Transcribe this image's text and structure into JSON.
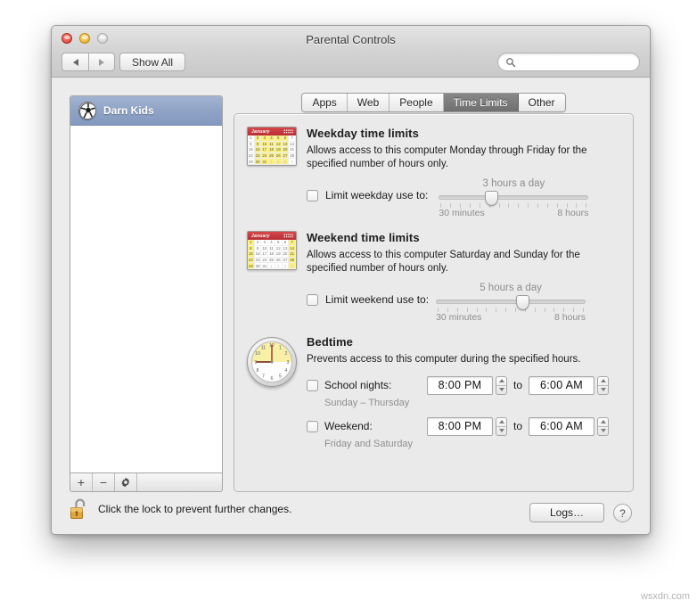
{
  "window": {
    "title": "Parental Controls",
    "traffic": {
      "close": "close-button",
      "minimize": "minimize-button",
      "zoom": "zoom-button"
    },
    "toolbar": {
      "back_label": "back",
      "forward_label": "forward",
      "show_all_label": "Show All",
      "search_placeholder": "",
      "search_value": ""
    }
  },
  "sidebar": {
    "users": [
      {
        "name": "Darn Kids",
        "avatar": "soccer-ball-icon",
        "selected": true
      }
    ],
    "toolbar": {
      "add_label": "+",
      "remove_label": "−",
      "action_label": "gear"
    }
  },
  "tabs": [
    {
      "label": "Apps",
      "active": false
    },
    {
      "label": "Web",
      "active": false
    },
    {
      "label": "People",
      "active": false
    },
    {
      "label": "Time Limits",
      "active": true
    },
    {
      "label": "Other",
      "active": false
    }
  ],
  "sections": {
    "weekday": {
      "icon": "calendar-icon",
      "calendar_month": "January",
      "title": "Weekday time limits",
      "description": "Allows access to this computer Monday through Friday for the specified number of hours only.",
      "checkbox_label": "Limit weekday use to:",
      "checked": false,
      "slider": {
        "value_label": "3 hours a day",
        "min_label": "30 minutes",
        "max_label": "8 hours",
        "percent": 35,
        "ticks": 16
      }
    },
    "weekend": {
      "icon": "calendar-icon",
      "calendar_month": "January",
      "title": "Weekend time limits",
      "description": "Allows access to this computer Saturday and Sunday for the specified number of hours only.",
      "checkbox_label": "Limit weekend use to:",
      "checked": false,
      "slider": {
        "value_label": "5 hours a day",
        "min_label": "30 minutes",
        "max_label": "8 hours",
        "percent": 58,
        "ticks": 16
      }
    },
    "bedtime": {
      "icon": "clock-icon",
      "title": "Bedtime",
      "description": "Prevents access to this computer during the specified hours.",
      "rows": [
        {
          "checkbox_label": "School nights:",
          "checked": false,
          "start_time": "8:00 PM",
          "to_label": "to",
          "end_time": "6:00 AM",
          "note": "Sunday – Thursday"
        },
        {
          "checkbox_label": "Weekend:",
          "checked": false,
          "start_time": "8:00 PM",
          "to_label": "to",
          "end_time": "6:00 AM",
          "note": "Friday and Saturday"
        }
      ]
    }
  },
  "footer": {
    "lock_icon": "unlocked-padlock-icon",
    "lock_text": "Click the lock to prevent further changes.",
    "logs_label": "Logs…",
    "help_label": "?"
  },
  "watermark": "wsxdn.com",
  "calendar_rows": [
    [
      "1",
      "2",
      "3",
      "4",
      "5",
      "6",
      "7"
    ],
    [
      "8",
      "9",
      "10",
      "11",
      "12",
      "13",
      "14"
    ],
    [
      "15",
      "16",
      "17",
      "18",
      "19",
      "20",
      "21"
    ],
    [
      "22",
      "23",
      "24",
      "25",
      "26",
      "27",
      "28"
    ],
    [
      "29",
      "30",
      "31",
      "1",
      "2",
      "3",
      "4"
    ]
  ],
  "colors": {
    "selection_blue": "#8fa3c6",
    "tab_active": "#7a7a7a",
    "calendar_red": "#c33a3f",
    "calendar_highlight": "#fbf07c",
    "lock_gold": "#e0a73c"
  }
}
